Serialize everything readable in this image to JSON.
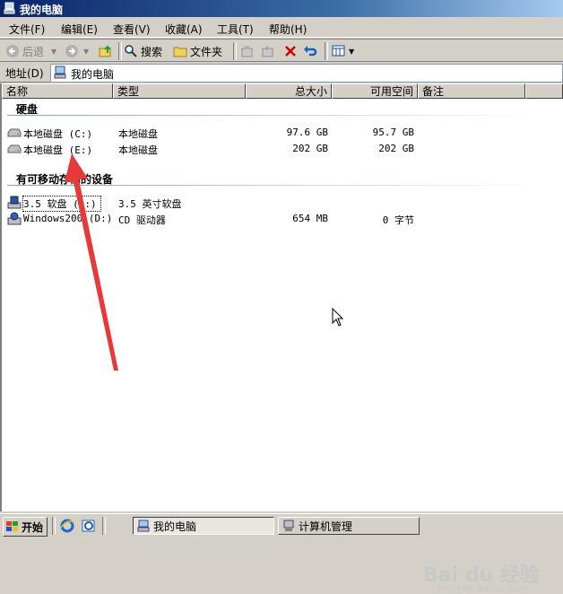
{
  "window": {
    "title": "我的电脑"
  },
  "menu": [
    "文件(F)",
    "编辑(E)",
    "查看(V)",
    "收藏(A)",
    "工具(T)",
    "帮助(H)"
  ],
  "toolbar": {
    "back": "后退",
    "search": "搜索",
    "folders": "文件夹"
  },
  "address": {
    "label": "地址(D)",
    "value": "我的电脑"
  },
  "columns": [
    "名称",
    "类型",
    "总大小",
    "可用空间",
    "备注"
  ],
  "groups": {
    "hard_disks": "硬盘",
    "removable": "有可移动存储的设备"
  },
  "drives": [
    {
      "name": "本地磁盘 (C:)",
      "type": "本地磁盘",
      "total": "97.6 GB",
      "free": "95.7 GB"
    },
    {
      "name": "本地磁盘 (E:)",
      "type": "本地磁盘",
      "total": "202 GB",
      "free": "202 GB"
    }
  ],
  "removable": [
    {
      "name": "3.5 软盘 (A:)",
      "type": "3.5 英寸软盘",
      "total": "",
      "free": ""
    },
    {
      "name": "Windows200 (D:)",
      "type": "CD 驱动器",
      "total": "654 MB",
      "free": "0 字节"
    }
  ],
  "taskbar": {
    "start": "开始",
    "tasks": [
      "我的电脑",
      "计算机管理"
    ]
  },
  "watermark": {
    "logo": "Bai du 经验",
    "url": "jingyan.baidu.com"
  },
  "colors": {
    "titlebar": "#0a246a",
    "arrow": "#e8393a",
    "face": "#d4d0c8"
  }
}
